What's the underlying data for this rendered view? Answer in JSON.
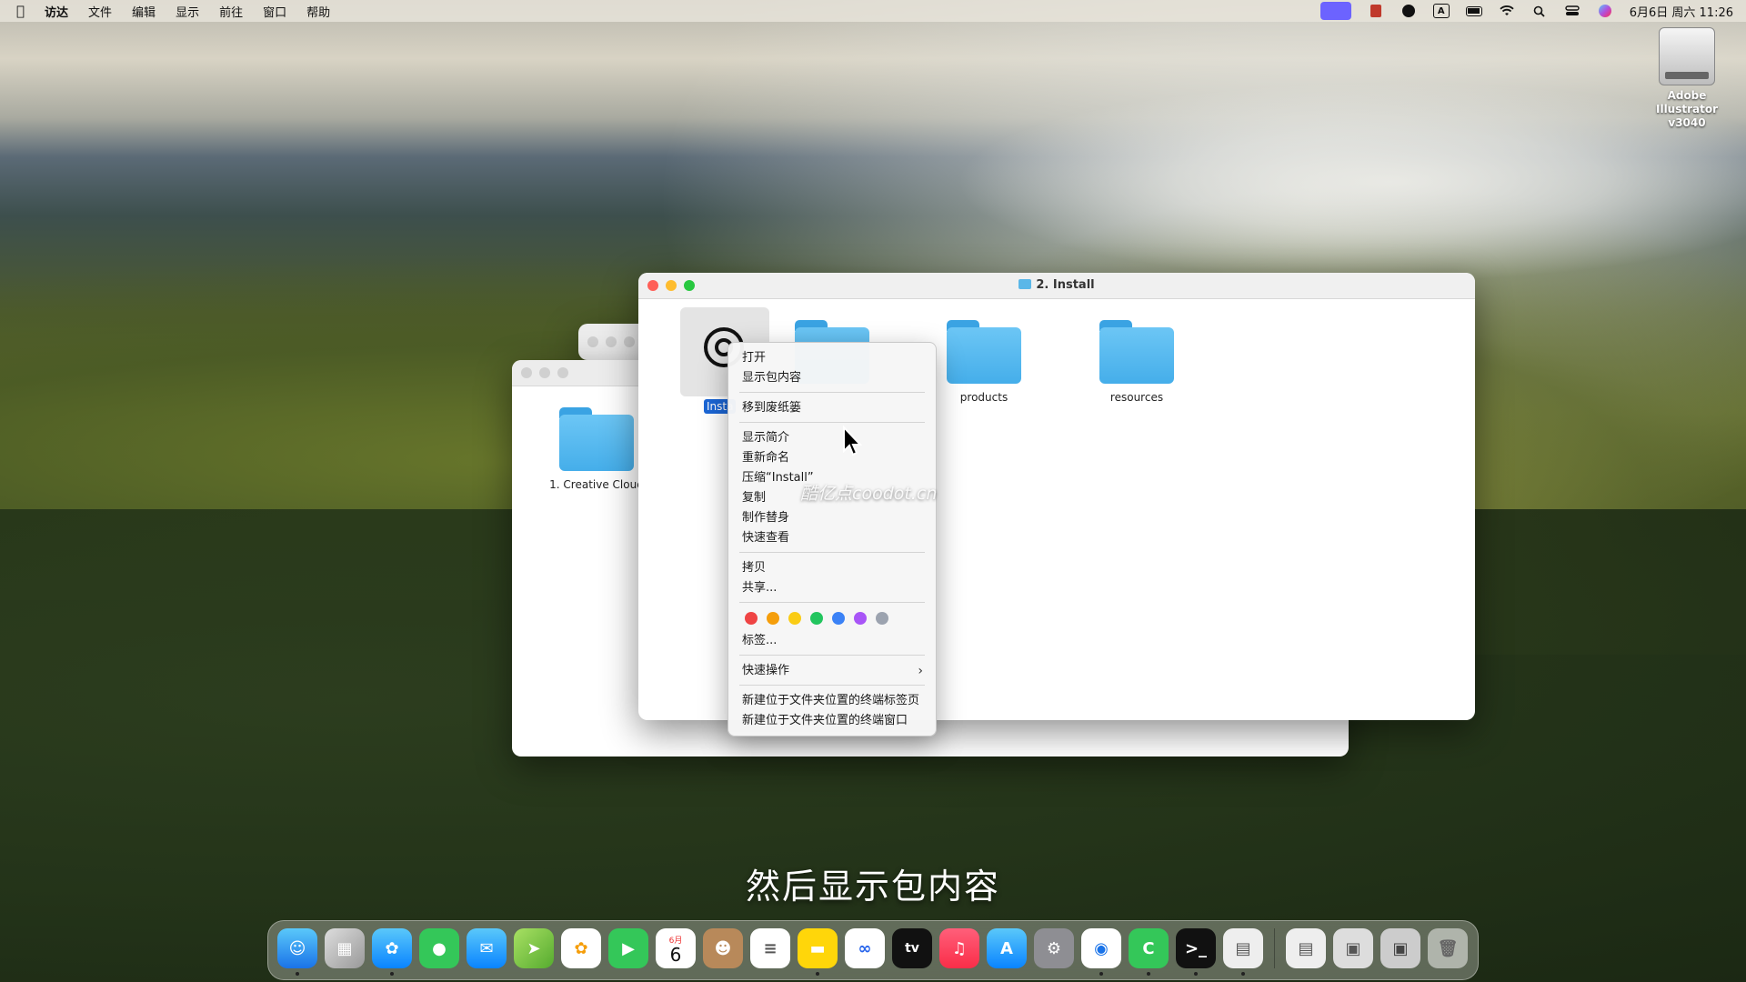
{
  "menubar": {
    "app": "访达",
    "items": [
      "文件",
      "编辑",
      "显示",
      "前往",
      "窗口",
      "帮助"
    ],
    "input_method": "A",
    "datetime": "6月6日 周六  11:26"
  },
  "desktop": {
    "drive_label_1": "Adobe Illustrator",
    "drive_label_2": "v3040"
  },
  "back_window": {
    "folder_name": "1. Creative Cloud"
  },
  "main_window": {
    "title": "2. Install",
    "selected_item_label": "Insta",
    "folders": [
      "products",
      "resources"
    ]
  },
  "context_menu": {
    "open": "打开",
    "show_package": "显示包内容",
    "trash": "移到废纸篓",
    "get_info": "显示简介",
    "rename": "重新命名",
    "compress": "压缩“Install”",
    "duplicate": "复制",
    "make_alias": "制作替身",
    "quick_look": "快速查看",
    "copy": "拷贝",
    "share": "共享...",
    "tags_label": "标签...",
    "quick_actions": "快速操作",
    "new_terminal_tab": "新建位于文件夹位置的终端标签页",
    "new_terminal_window": "新建位于文件夹位置的终端窗口",
    "tag_colors": [
      "#ef4444",
      "#f59e0b",
      "#facc15",
      "#22c55e",
      "#3b82f6",
      "#a855f7",
      "#9ca3af"
    ]
  },
  "watermark": "酷亿点coodot.cn",
  "subtitle": "然后显示包内容",
  "dock": {
    "calendar_month": "6月",
    "calendar_day": "6",
    "tv_label": "tv"
  }
}
